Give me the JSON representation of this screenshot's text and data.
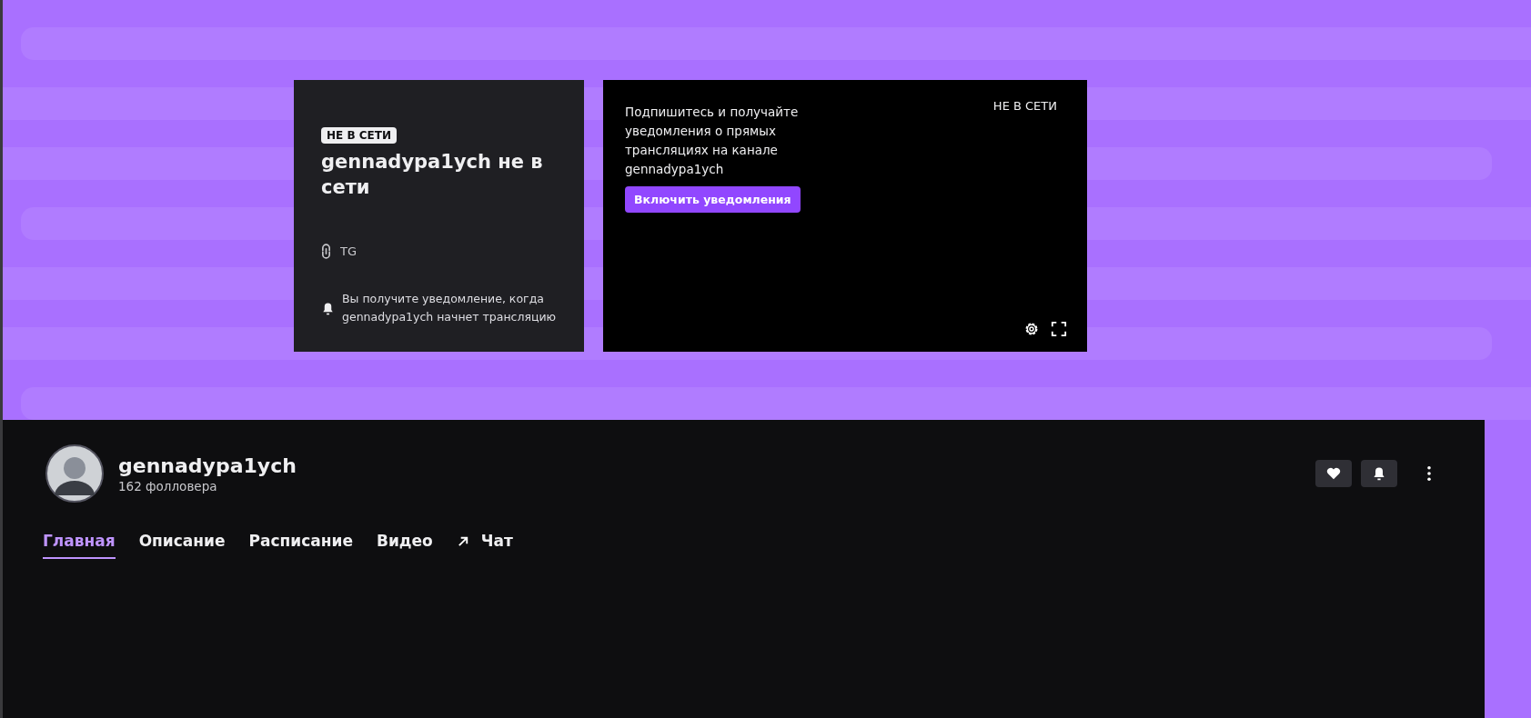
{
  "offline_card": {
    "badge": "НЕ В СЕТИ",
    "title": "gennadypa1ych не в сети",
    "link": "TG",
    "notice": "Вы получите уведомление, когда gennadypa1ych начнет трансляцию"
  },
  "player": {
    "message": "Подпишитесь и получайте уведомления о прямых трансляциях на канале gennadypa1ych",
    "button": "Включить уведомления",
    "status": "НЕ В СЕТИ"
  },
  "channel": {
    "name": "gennadypa1ych",
    "followers": "162 фолловера"
  },
  "tabs": [
    {
      "label": "Главная",
      "selected": true,
      "kind": "plain"
    },
    {
      "label": "Описание",
      "selected": false,
      "kind": "plain"
    },
    {
      "label": "Расписание",
      "selected": false,
      "kind": "plain"
    },
    {
      "label": "Видео",
      "selected": false,
      "kind": "plain"
    },
    {
      "label": "Чат",
      "selected": false,
      "kind": "external"
    }
  ]
}
